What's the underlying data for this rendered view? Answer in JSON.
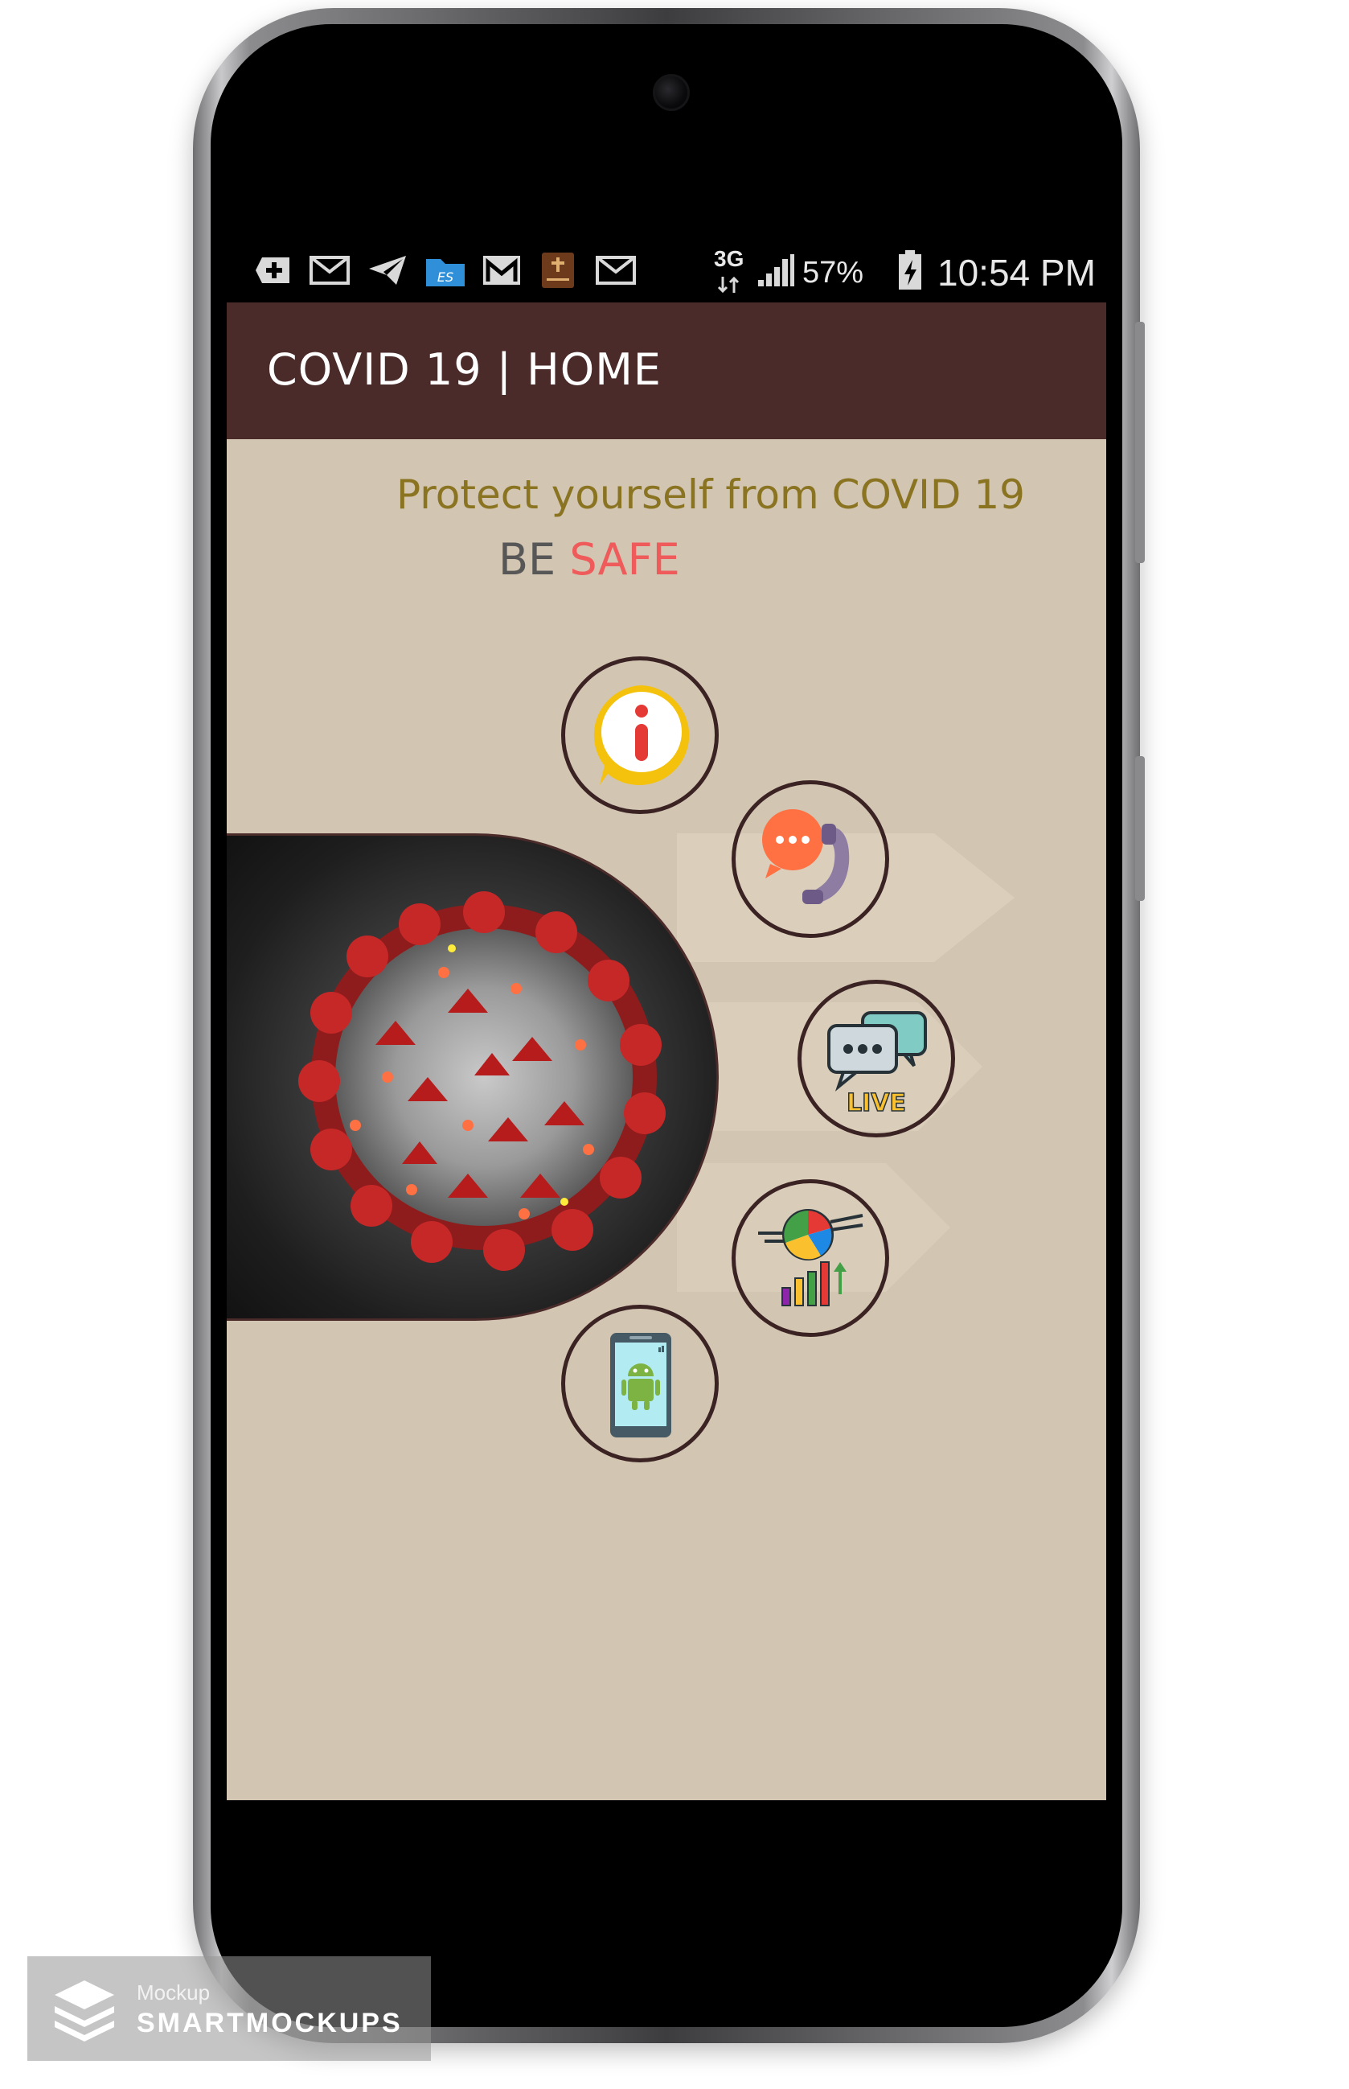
{
  "status_bar": {
    "network": "3G",
    "battery": "57%",
    "time": "10:54 PM",
    "notification_icons": [
      "add-box-icon",
      "mail-icon",
      "telegram-icon",
      "file-manager-icon",
      "gmail-icon",
      "bible-app-icon",
      "mail-icon"
    ]
  },
  "app_bar": {
    "title": "COVID 19 | HOME"
  },
  "home": {
    "tagline": "Protect yourself from COVID 19",
    "be": "BE",
    "safe": "SAFE"
  },
  "menu": [
    {
      "name": "info",
      "icon": "info-icon"
    },
    {
      "name": "contact",
      "icon": "phone-chat-icon"
    },
    {
      "name": "live",
      "icon": "live-chat-icon"
    },
    {
      "name": "statistics",
      "icon": "statistics-icon"
    },
    {
      "name": "about",
      "icon": "android-phone-icon"
    }
  ],
  "watermark": {
    "line1": "Mockup",
    "line2": "SMARTMOCKUPS"
  },
  "colors": {
    "app_bar": "#4a2b2a",
    "background": "#d2c5b1",
    "tagline": "#8a7422",
    "safe": "#ef5a5a"
  }
}
